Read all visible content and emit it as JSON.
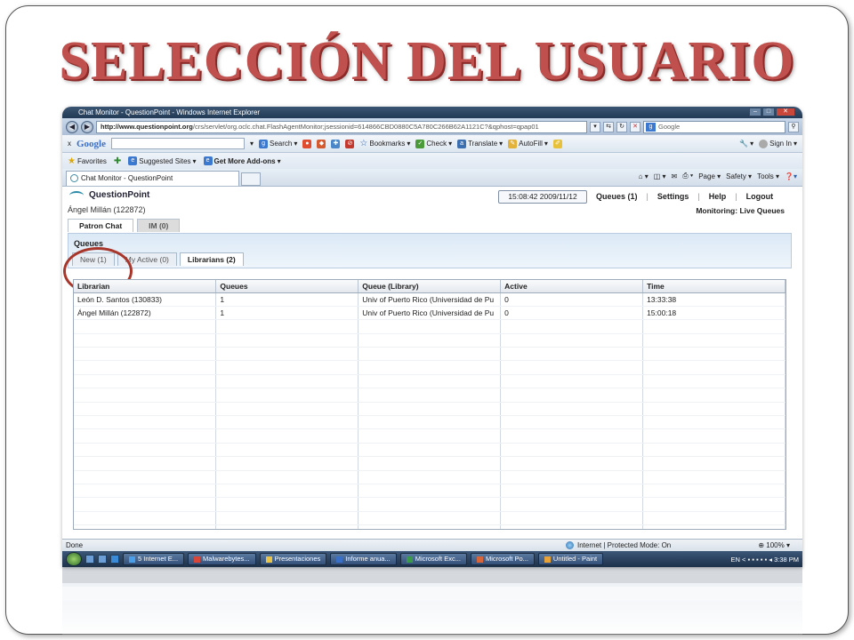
{
  "slide": {
    "title": "SELECCIÓN DEL USUARIO"
  },
  "browser": {
    "window_title": "Chat Monitor - QuestionPoint - Windows Internet Explorer",
    "url_host": "http://www.questionpoint.org",
    "url_path": "/crs/servlet/org.oclc.chat.FlashAgentMonitor;jsessionid=614866CBD0880C5A780C266B62A1121C?&qphost=qpap01",
    "search_placeholder": "Google",
    "google_toolbar": {
      "close": "x",
      "logo": "Google",
      "search": "Search",
      "bookmarks": "Bookmarks",
      "check": "Check",
      "translate": "Translate",
      "autofill": "AutoFill",
      "sign_in": "Sign In"
    },
    "favorites": {
      "label": "Favorites",
      "suggested": "Suggested Sites",
      "addons": "Get More Add-ons"
    },
    "tab_title": "Chat Monitor - QuestionPoint",
    "commands": {
      "page": "Page",
      "safety": "Safety",
      "tools": "Tools"
    },
    "status": {
      "left": "Done",
      "zone": "Internet | Protected Mode: On",
      "zoom": "100%"
    }
  },
  "app": {
    "logo": "QuestionPoint",
    "agent": "Ángel Millán (122872)",
    "clock": "15:08:42 2009/11/12",
    "nav": {
      "queues": "Queues (1)",
      "settings": "Settings",
      "help": "Help",
      "logout": "Logout"
    },
    "monitoring": "Monitoring: Live Queues",
    "main_tabs": [
      "Patron Chat",
      "IM (0)"
    ],
    "panel_title": "Queues",
    "sub_tabs": [
      "New (1)",
      "My Active (0)",
      "Librarians (2)"
    ],
    "table": {
      "headers": [
        "Librarian",
        "Queues",
        "Queue (Library)",
        "Active",
        "Time"
      ],
      "rows": [
        [
          "León D. Santos (130833)",
          "1",
          "Univ of Puerto Rico (Universidad de Pu",
          "0",
          "13:33:38"
        ],
        [
          "Ángel Millán (122872)",
          "1",
          "Univ of Puerto Rico (Universidad de Pu",
          "0",
          "15:00:18"
        ]
      ]
    }
  },
  "taskbar": {
    "items": [
      "5 Internet E...",
      "Malwarebytes...",
      "Presentaciones",
      "Informe anua...",
      "Microsoft Exc...",
      "Microsoft Po...",
      "Untitled - Paint"
    ],
    "tray": "EN",
    "clock": "3:38 PM"
  },
  "colors": {
    "title_red": "#c0504d",
    "annotation_circle": "#a8362b"
  }
}
